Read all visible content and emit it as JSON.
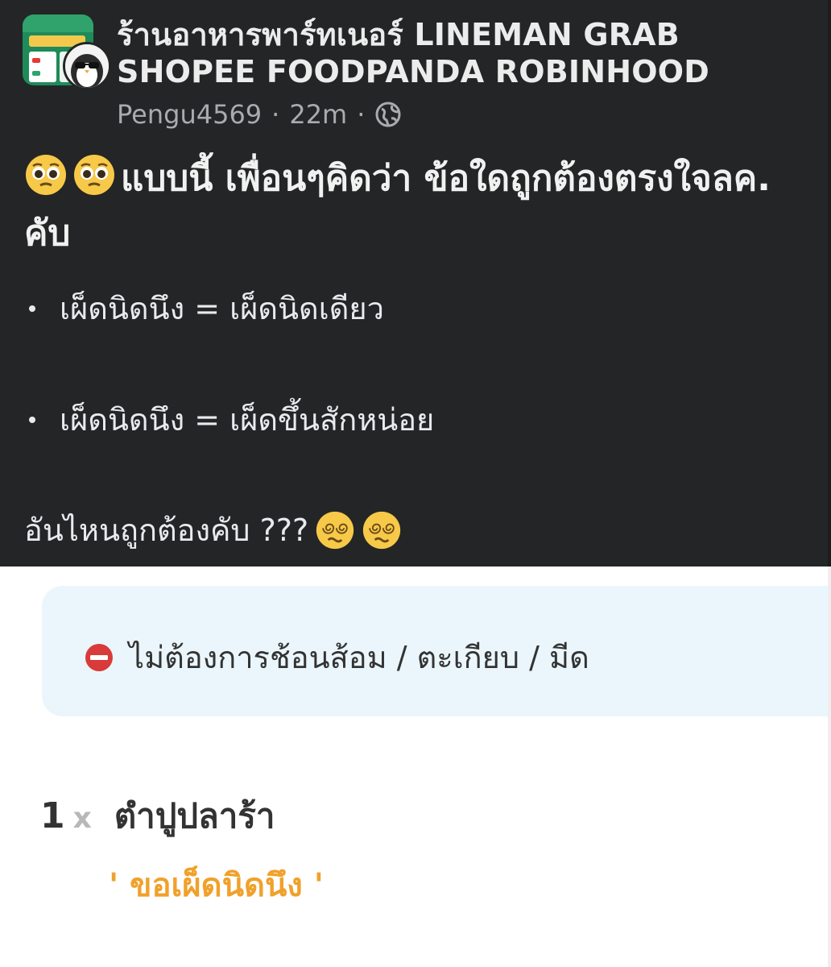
{
  "post": {
    "group_title": "ร้านอาหารพาร์ทเนอร์ LINEMAN GRAB SHOPEE FOODPANDA ROBINHOOD",
    "author": "Pengu4569",
    "time": "22m",
    "separator": "·",
    "privacy_icon": "globe-icon",
    "headline": "แบบนี้ เพื่อนๆคิดว่า  ข้อใดถูกต้องตรงใจลค. คับ",
    "headline_emoji": "pleading-face",
    "bullets": [
      "เผ็ดนิดนึง  = เผ็ดนิดเดียว",
      "เผ็ดนิดนึง = เผ็ดขึ้นสักหน่อย"
    ],
    "question": "อันไหนถูกต้องคับ  ???",
    "question_emoji": "dizzy-face"
  },
  "order": {
    "note": "ไม่ต้องการช้อนส้อม / ตะเกียบ / มีด",
    "note_icon": "no-entry-icon",
    "quantity": "1",
    "times_symbol": "x",
    "item_name": "ตำปูปลาร้า",
    "item_note": "' ขอเผ็ดนิดนึง '"
  },
  "colors": {
    "post_bg": "#242526",
    "note_bg": "#eaf6fc",
    "accent_orange": "#f0a12b"
  }
}
